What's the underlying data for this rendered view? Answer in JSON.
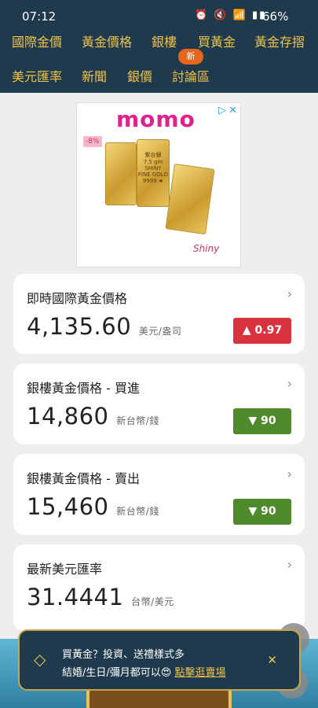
{
  "status": {
    "time": "07:12",
    "icons": "⏰ 🔇 📶 ▮▮",
    "battery": "66%"
  },
  "nav": {
    "row1": [
      "國際金價",
      "黃金價格",
      "銀樓",
      "買黃金",
      "黃金存摺"
    ],
    "row2": [
      "美元匯率",
      "新聞",
      "銀價",
      "討論區"
    ],
    "new_badge": "新"
  },
  "ad": {
    "logo": "momo",
    "discount": "-8%",
    "bar_text": "紫台銀\n7.5 gm\nSHINY\nFINE GOLD\n9999 ★",
    "brand": "Shiny"
  },
  "cards": [
    {
      "title": "即時國際黃金價格",
      "value": "4,135.60",
      "unit": "美元/盎司",
      "change": "▲ 0.97",
      "direction": "up"
    },
    {
      "title": "銀樓黃金價格 - 買進",
      "value": "14,860",
      "unit": "新台幣/錢",
      "change": "▼ 90",
      "direction": "down"
    },
    {
      "title": "銀樓黃金價格 - 賣出",
      "value": "15,460",
      "unit": "新台幣/錢",
      "change": "▼ 90",
      "direction": "down"
    },
    {
      "title": "最新美元匯率",
      "value": "31.4441",
      "unit": "台幣/美元"
    }
  ],
  "toast": {
    "line1": "買黃金？投資、送禮樣式多",
    "line2_prefix": "結婚/生日/彌月都可以😍 ",
    "link": "點擊逛賣場",
    "close": "✕"
  },
  "colors": {
    "header_bg": "#1e3a4c",
    "nav_text": "#f0c24a",
    "up": "#d9333f",
    "down": "#4f8a2c"
  }
}
